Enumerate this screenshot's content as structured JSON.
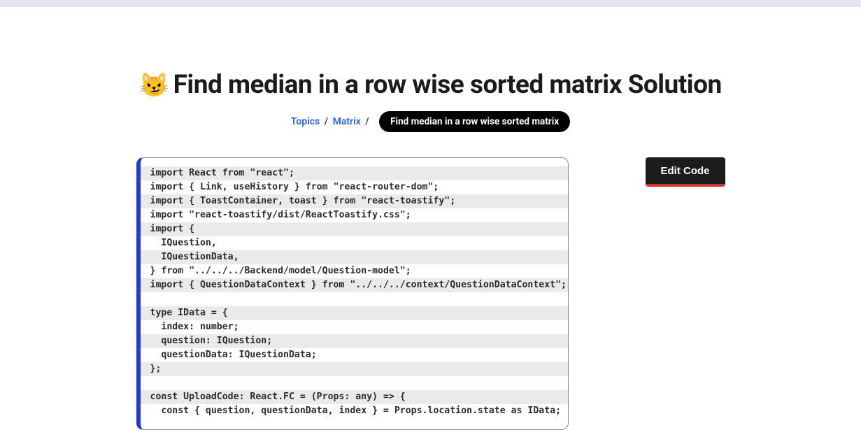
{
  "header": {
    "emoji": "😼",
    "title": "Find median in a row wise sorted matrix Solution"
  },
  "breadcrumb": {
    "topics": "Topics",
    "category": "Matrix",
    "current": "Find median in a row wise sorted matrix"
  },
  "actions": {
    "edit": "Edit Code"
  },
  "code_lines": [
    "import React from \"react\";",
    "import { Link, useHistory } from \"react-router-dom\";",
    "import { ToastContainer, toast } from \"react-toastify\";",
    "import \"react-toastify/dist/ReactToastify.css\";",
    "import {",
    "  IQuestion,",
    "  IQuestionData,",
    "} from \"../../../Backend/model/Question-model\";",
    "import { QuestionDataContext } from \"../../../context/QuestionDataContext\";",
    "",
    "type IData = {",
    "  index: number;",
    "  question: IQuestion;",
    "  questionData: IQuestionData;",
    "};",
    "",
    "const UploadCode: React.FC = (Props: any) => {",
    "  const { question, questionData, index } = Props.location.state as IData;"
  ]
}
